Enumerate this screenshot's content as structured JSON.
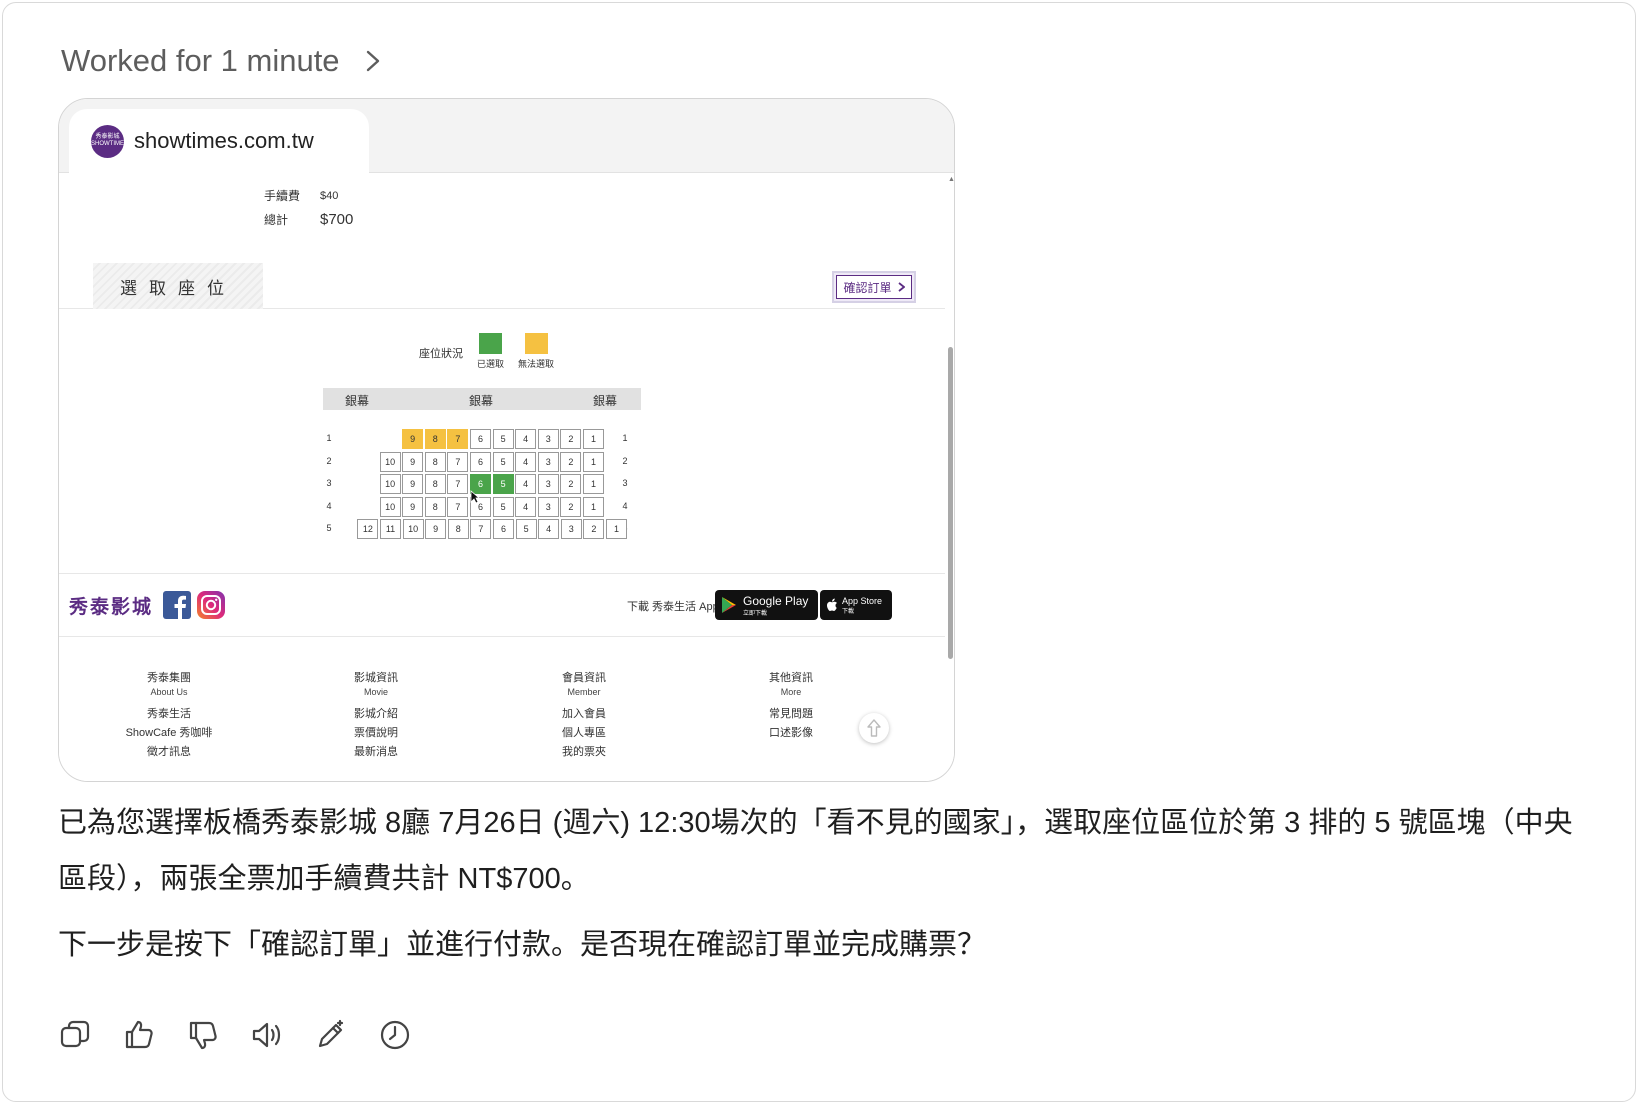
{
  "header": {
    "worked_label": "Worked for 1 minute"
  },
  "browser": {
    "tab_url": "showtimes.com.tw",
    "favicon_text": "秀泰影城 SHOWTIME"
  },
  "order": {
    "fee_label": "手續費",
    "fee_value": "$40",
    "total_label": "總計",
    "total_value": "$700",
    "section_title": "選取座位",
    "confirm_label": "確認訂單"
  },
  "legend": {
    "label": "座位狀況",
    "selected_label": "已選取",
    "unavailable_label": "無法選取",
    "selected_color": "#4aa44a",
    "unavailable_color": "#f5c141"
  },
  "screen": {
    "labels": [
      "銀幕",
      "銀幕",
      "銀幕"
    ]
  },
  "seat_rows": [
    {
      "row": "1",
      "seats": [
        {
          "n": "9",
          "s": "unavail"
        },
        {
          "n": "8",
          "s": "unavail"
        },
        {
          "n": "7",
          "s": "unavail"
        },
        {
          "n": "6",
          "s": "open"
        },
        {
          "n": "5",
          "s": "open"
        },
        {
          "n": "4",
          "s": "open"
        },
        {
          "n": "3",
          "s": "open"
        },
        {
          "n": "2",
          "s": "open"
        },
        {
          "n": "1",
          "s": "open"
        }
      ]
    },
    {
      "row": "2",
      "seats": [
        {
          "n": "10",
          "s": "open"
        },
        {
          "n": "9",
          "s": "open"
        },
        {
          "n": "8",
          "s": "open"
        },
        {
          "n": "7",
          "s": "open"
        },
        {
          "n": "6",
          "s": "open"
        },
        {
          "n": "5",
          "s": "open"
        },
        {
          "n": "4",
          "s": "open"
        },
        {
          "n": "3",
          "s": "open"
        },
        {
          "n": "2",
          "s": "open"
        },
        {
          "n": "1",
          "s": "open"
        }
      ]
    },
    {
      "row": "3",
      "seats": [
        {
          "n": "10",
          "s": "open"
        },
        {
          "n": "9",
          "s": "open"
        },
        {
          "n": "8",
          "s": "open"
        },
        {
          "n": "7",
          "s": "open"
        },
        {
          "n": "6",
          "s": "selected"
        },
        {
          "n": "5",
          "s": "selected"
        },
        {
          "n": "4",
          "s": "open"
        },
        {
          "n": "3",
          "s": "open"
        },
        {
          "n": "2",
          "s": "open"
        },
        {
          "n": "1",
          "s": "open"
        }
      ]
    },
    {
      "row": "4",
      "seats": [
        {
          "n": "10",
          "s": "open"
        },
        {
          "n": "9",
          "s": "open"
        },
        {
          "n": "8",
          "s": "open"
        },
        {
          "n": "7",
          "s": "open"
        },
        {
          "n": "6",
          "s": "open"
        },
        {
          "n": "5",
          "s": "open"
        },
        {
          "n": "4",
          "s": "open"
        },
        {
          "n": "3",
          "s": "open"
        },
        {
          "n": "2",
          "s": "open"
        },
        {
          "n": "1",
          "s": "open"
        }
      ]
    },
    {
      "row": "5",
      "seats": [
        {
          "n": "12",
          "s": "open"
        },
        {
          "n": "11",
          "s": "open"
        },
        {
          "n": "10",
          "s": "open"
        },
        {
          "n": "9",
          "s": "open"
        },
        {
          "n": "8",
          "s": "open"
        },
        {
          "n": "7",
          "s": "open"
        },
        {
          "n": "6",
          "s": "open"
        },
        {
          "n": "5",
          "s": "open"
        },
        {
          "n": "4",
          "s": "open"
        },
        {
          "n": "3",
          "s": "open"
        },
        {
          "n": "2",
          "s": "open"
        },
        {
          "n": "1",
          "s": "open"
        }
      ]
    }
  ],
  "footer": {
    "brand": "秀泰影城",
    "download_text": "下載 秀泰生活 App",
    "google_play": {
      "line1": "Google Play",
      "line2": "立即下載"
    },
    "app_store": {
      "line1": "App Store",
      "line2": "下載"
    },
    "columns": [
      {
        "title": "秀泰集團",
        "sub": "About Us",
        "items": [
          "秀泰生活",
          "ShowCafe 秀咖啡",
          "徵才訊息"
        ]
      },
      {
        "title": "影城資訊",
        "sub": "Movie",
        "items": [
          "影城介紹",
          "票價說明",
          "最新消息"
        ]
      },
      {
        "title": "會員資訊",
        "sub": "Member",
        "items": [
          "加入會員",
          "個人專區",
          "我的票夾"
        ]
      },
      {
        "title": "其他資訊",
        "sub": "More",
        "items": [
          "常見問題",
          "口述影像"
        ]
      }
    ]
  },
  "message": {
    "paragraph1": "已為您選擇板橋秀泰影城 8廳 7月26日 (週六) 12:30場次的「看不見的國家」，選取座位區位於第 3 排的 5 號區塊（中央區段），兩張全票加手續費共計 NT$700。",
    "paragraph2": "下一步是按下「確認訂單」並進行付款。是否現在確認訂單並完成購票？"
  }
}
